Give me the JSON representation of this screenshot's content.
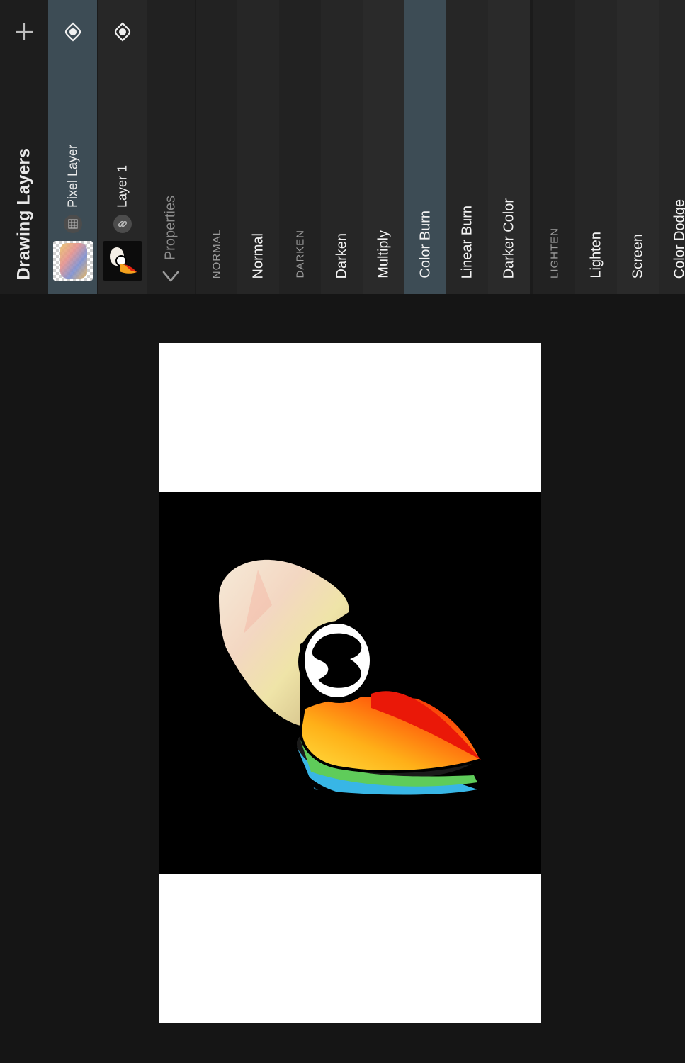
{
  "panel": {
    "title": "Drawing Layers",
    "properties_label": "Properties"
  },
  "layers": [
    {
      "name": "Pixel Layer",
      "selected": true,
      "type_icon": "grid-icon"
    },
    {
      "name": "Layer 1",
      "selected": false,
      "type_icon": "link-icon"
    }
  ],
  "blend_modes": [
    {
      "label": "NORMAL",
      "kind": "header"
    },
    {
      "label": "Normal",
      "kind": "item"
    },
    {
      "label": "DARKEN",
      "kind": "header"
    },
    {
      "label": "Darken",
      "kind": "item"
    },
    {
      "label": "Multiply",
      "kind": "item"
    },
    {
      "label": "Color Burn",
      "kind": "item",
      "selected": true
    },
    {
      "label": "Linear Burn",
      "kind": "item"
    },
    {
      "label": "Darker Color",
      "kind": "item"
    },
    {
      "label": "LIGHTEN",
      "kind": "header"
    },
    {
      "label": "Lighten",
      "kind": "item"
    },
    {
      "label": "Screen",
      "kind": "item"
    },
    {
      "label": "Color Dodge",
      "kind": "item"
    }
  ],
  "colors": {
    "selected_bg": "#3d4c55",
    "panel_bg": "#1b1b1b",
    "canvas_bg": "#ffffff",
    "artwork_bg": "#000000"
  }
}
